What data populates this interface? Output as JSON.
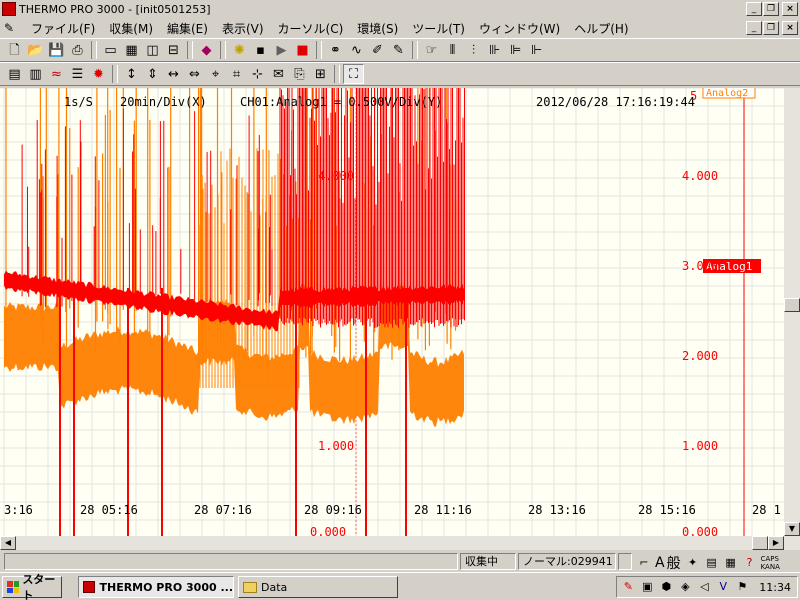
{
  "window": {
    "title": "THERMO PRO 3000 - [init0501253]"
  },
  "menu": [
    {
      "label": "ファイル(F)"
    },
    {
      "label": "収集(M)"
    },
    {
      "label": "編集(E)"
    },
    {
      "label": "表示(V)"
    },
    {
      "label": "カーソル(C)"
    },
    {
      "label": "環境(S)"
    },
    {
      "label": "ツール(T)"
    },
    {
      "label": "ウィンドウ(W)"
    },
    {
      "label": "ヘルプ(H)"
    }
  ],
  "toolbar1_icons": [
    "new-file-icon",
    "open-folder-icon",
    "save-icon",
    "print-icon",
    "sep",
    "window-icon",
    "tile-icon",
    "split-vertical-icon",
    "split-horizontal-icon",
    "sep",
    "tag-icon",
    "sep",
    "sun-setting-icon",
    "floppy-icon",
    "play-icon",
    "stop-icon",
    "sep",
    "binoculars-icon",
    "wave-icon",
    "pen-icon",
    "edit-icon",
    "sep",
    "hand-icon",
    "channel-a-icon",
    "channel-b-icon",
    "channel-c-icon",
    "channel-d-icon",
    "channel-e-icon"
  ],
  "toolbar2_icons": [
    "chart-window-icon",
    "chart-multi-icon",
    "chart-wave-icon",
    "chart-list-icon",
    "sparkle-icon",
    "sep",
    "expand-vertical-icon",
    "compress-vertical-icon",
    "expand-horizontal-icon",
    "compress-horizontal-icon",
    "cursor-a-icon",
    "cursor-b-icon",
    "cursor-c-icon",
    "envelope-icon",
    "envelope-open-icon",
    "grid-icon",
    "sep",
    "fit-icon"
  ],
  "graph": {
    "sample_rate": "1s/S",
    "time_div": "20min/Div(X)",
    "channel_info": "CH01:Analog1 = 0.500V/Div(Y)",
    "datetime": "2012/06/28   17:16:19:44",
    "channel_labels": [
      "Analog2",
      "Analog1"
    ],
    "colors": {
      "background": "#fffff4",
      "grid": "#e0e0e0",
      "analog1": "#ff0000",
      "analog2": "#ff8000"
    },
    "y_axis_right": [
      "4.000",
      "3.000",
      "2.000",
      "1.000"
    ],
    "y_axis_mid": [
      "4.000",
      "1.000",
      "0.000"
    ],
    "y_axis_right_top": "5",
    "y_axis_right_bottom": "0.000",
    "x_axis": [
      "3:16",
      "28 05:16",
      "28 07:16",
      "28 09:16",
      "28 11:16",
      "28 13:16",
      "28 15:16",
      "28 1"
    ]
  },
  "status": {
    "state": "収集中",
    "normal": "ノーマル:029941"
  },
  "taskbar": {
    "start": "スタート",
    "tasks": [
      "THERMO PRO 3000 ...",
      "Data"
    ],
    "ime_mode": "般",
    "ime_a": "A",
    "caps": "CAPS",
    "kana": "KANA",
    "clock": "11:34"
  }
}
